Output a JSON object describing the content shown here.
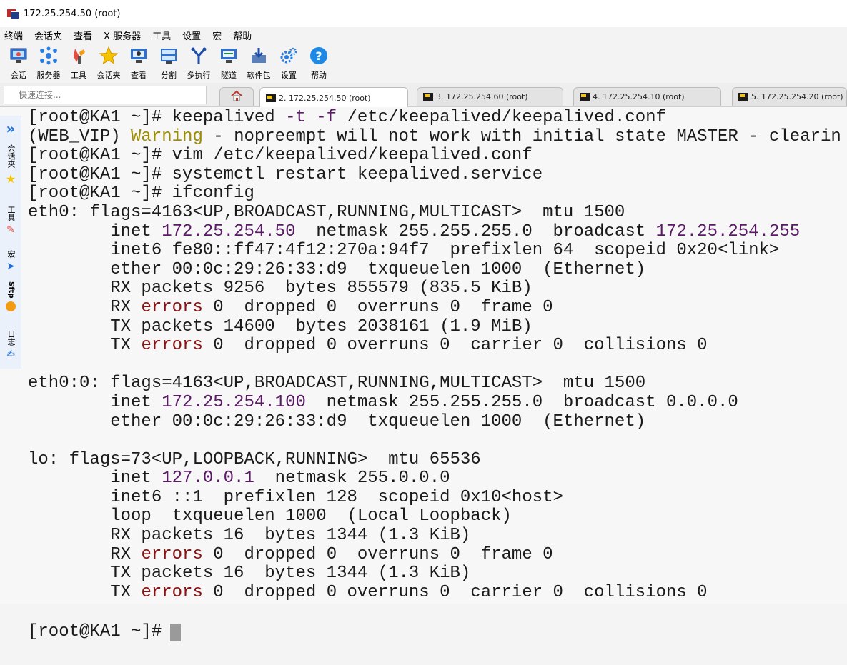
{
  "window": {
    "title": "172.25.254.50 (root)"
  },
  "menu": [
    "终端",
    "会话夹",
    "查看",
    "X 服务器",
    "工具",
    "设置",
    "宏",
    "帮助"
  ],
  "toolbar": [
    {
      "label": "会话",
      "icon": "session-icon"
    },
    {
      "label": "服务器",
      "icon": "servers-icon"
    },
    {
      "label": "工具",
      "icon": "tools-icon"
    },
    {
      "label": "会话夹",
      "icon": "star-icon"
    },
    {
      "label": "查看",
      "icon": "view-icon"
    },
    {
      "label": "分割",
      "icon": "split-icon"
    },
    {
      "label": "多执行",
      "icon": "multiexec-icon"
    },
    {
      "label": "隧道",
      "icon": "tunnel-icon"
    },
    {
      "label": "软件包",
      "icon": "packages-icon"
    },
    {
      "label": "设置",
      "icon": "settings-icon"
    },
    {
      "label": "帮助",
      "icon": "help-icon"
    }
  ],
  "quick_connect": {
    "placeholder": "快速连接..."
  },
  "tabs": [
    {
      "label": "2. 172.25.254.50 (root)",
      "active": true
    },
    {
      "label": "3. 172.25.254.60 (root)",
      "active": false
    },
    {
      "label": "4. 172.25.254.10 (root)",
      "active": false
    },
    {
      "label": "5. 172.25.254.20 (root)",
      "active": false
    }
  ],
  "side_panel": [
    "会话夹",
    "工具",
    "宏",
    "Sftp",
    "日志"
  ],
  "terminal": {
    "lines": [
      [
        {
          "t": "[root@KA1 ~]# keepalived "
        },
        {
          "t": "-t -f",
          "c": "purple"
        },
        {
          "t": " /etc/keepalived/keepalived.conf"
        }
      ],
      [
        {
          "t": "(WEB_VIP) "
        },
        {
          "t": "Warning",
          "c": "yellow"
        },
        {
          "t": " - nopreempt will not work with initial state MASTER - clearin"
        }
      ],
      [
        {
          "t": "[root@KA1 ~]# vim /etc/keepalived/keepalived.conf"
        }
      ],
      [
        {
          "t": "[root@KA1 ~]# systemctl restart keepalived.service"
        }
      ],
      [
        {
          "t": "[root@KA1 ~]# ifconfig"
        }
      ],
      [
        {
          "t": "eth0: flags=4163<UP,BROADCAST,RUNNING,MULTICAST>  mtu 1500"
        }
      ],
      [
        {
          "t": "        inet "
        },
        {
          "t": "172.25.254.50",
          "c": "purple"
        },
        {
          "t": "  netmask 255.255.255.0  broadcast "
        },
        {
          "t": "172.25.254.255",
          "c": "purple"
        }
      ],
      [
        {
          "t": "        inet6 fe80::ff47:4f12:270a:94f7  prefixlen 64  scopeid 0x20<link>"
        }
      ],
      [
        {
          "t": "        ether 00:0c:29:26:33:d9  txqueuelen 1000  (Ethernet)"
        }
      ],
      [
        {
          "t": "        RX packets 9256  bytes 855579 (835.5 KiB)"
        }
      ],
      [
        {
          "t": "        RX "
        },
        {
          "t": "errors",
          "c": "red"
        },
        {
          "t": " 0  dropped 0  overruns 0  frame 0"
        }
      ],
      [
        {
          "t": "        TX packets 14600  bytes 2038161 (1.9 MiB)"
        }
      ],
      [
        {
          "t": "        TX "
        },
        {
          "t": "errors",
          "c": "red"
        },
        {
          "t": " 0  dropped 0 overruns 0  carrier 0  collisions 0"
        }
      ],
      [
        {
          "t": ""
        }
      ],
      [
        {
          "t": "eth0:0: flags=4163<UP,BROADCAST,RUNNING,MULTICAST>  mtu 1500"
        }
      ],
      [
        {
          "t": "        inet "
        },
        {
          "t": "172.25.254.100",
          "c": "purple"
        },
        {
          "t": "  netmask 255.255.255.0  broadcast 0.0.0.0"
        }
      ],
      [
        {
          "t": "        ether 00:0c:29:26:33:d9  txqueuelen 1000  (Ethernet)"
        }
      ],
      [
        {
          "t": ""
        }
      ],
      [
        {
          "t": "lo: flags=73<UP,LOOPBACK,RUNNING>  mtu 65536"
        }
      ],
      [
        {
          "t": "        inet "
        },
        {
          "t": "127.0.0.1",
          "c": "purple"
        },
        {
          "t": "  netmask 255.0.0.0"
        }
      ],
      [
        {
          "t": "        inet6 ::1  prefixlen 128  scopeid 0x10<host>"
        }
      ],
      [
        {
          "t": "        loop  txqueuelen 1000  (Local Loopback)"
        }
      ],
      [
        {
          "t": "        RX packets 16  bytes 1344 (1.3 KiB)"
        }
      ],
      [
        {
          "t": "        RX "
        },
        {
          "t": "errors",
          "c": "red"
        },
        {
          "t": " 0  dropped 0  overruns 0  frame 0"
        }
      ],
      [
        {
          "t": "        TX packets 16  bytes 1344 (1.3 KiB)"
        }
      ],
      [
        {
          "t": "        TX "
        },
        {
          "t": "errors",
          "c": "red"
        },
        {
          "t": " 0  dropped 0 overruns 0  carrier 0  collisions 0"
        }
      ]
    ],
    "prompt": "[root@KA1 ~]#"
  },
  "colors": {
    "purple": "#5b1a66",
    "red": "#8a1212",
    "yellow": "#9b8c00",
    "terminal_bg": "#f7f7f7"
  }
}
